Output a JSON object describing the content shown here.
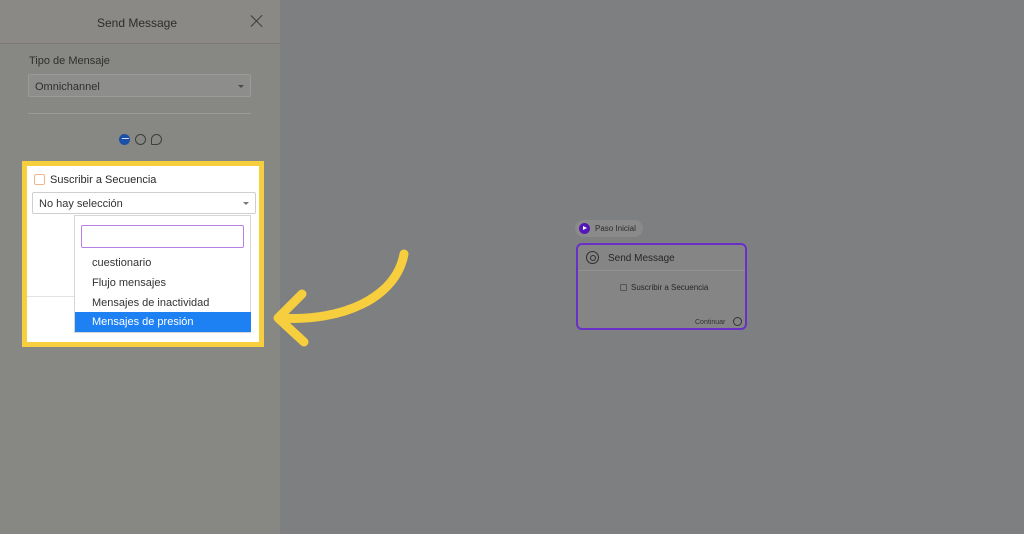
{
  "panel": {
    "title": "Send Message",
    "message_type_label": "Tipo de Mensaje",
    "message_type_value": "Omnichannel",
    "channels": [
      "messenger-icon",
      "whatsapp-icon",
      "chat-icon"
    ]
  },
  "sequence": {
    "label": "Suscribir a Secuencia",
    "selected": "No hay selección",
    "search_value": "",
    "options": [
      "cuestionario",
      "Flujo mensajes",
      "Mensajes de inactividad",
      "Mensajes de presión"
    ],
    "highlighted_option": "Mensajes de presión"
  },
  "flow": {
    "start_label": "Paso Inicial",
    "node_title": "Send Message",
    "node_action": "Suscribir a Secuencia",
    "continue_label": "Continuar"
  },
  "colors": {
    "highlight_border": "#f7cf3e",
    "selected_option": "#1d80f3",
    "node_border": "#6a2fc6",
    "search_focus": "#b87fe6"
  }
}
